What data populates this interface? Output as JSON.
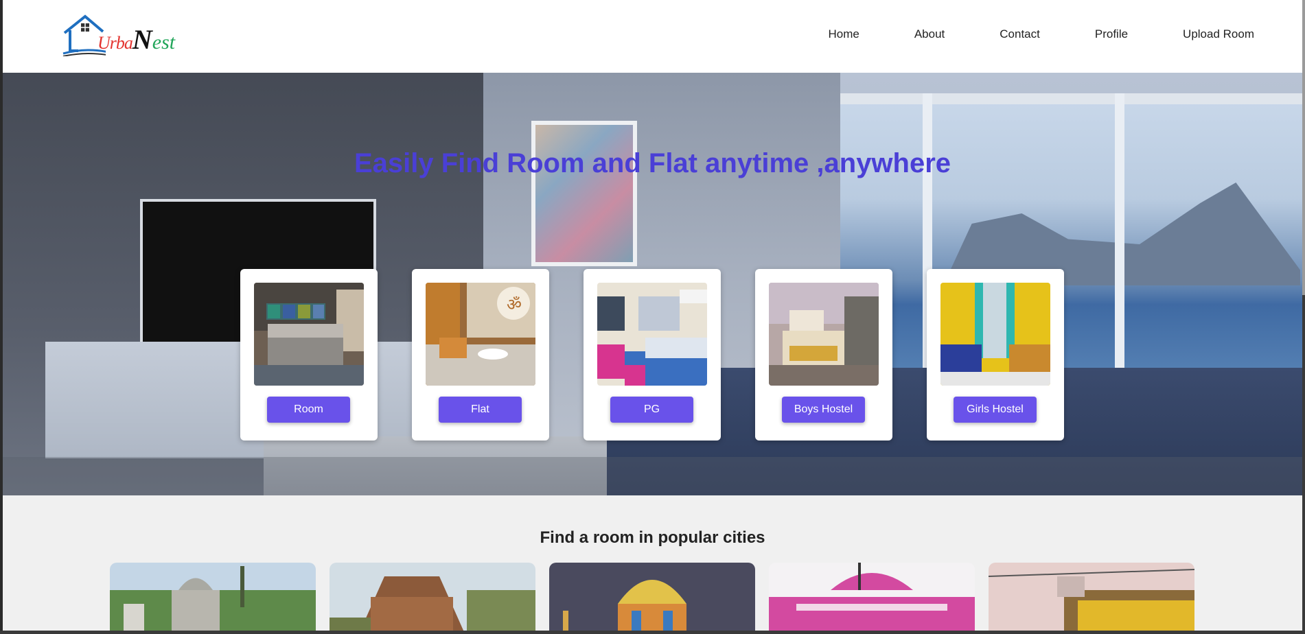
{
  "logo": {
    "part1": "Urba",
    "part2": "N",
    "part3": "est"
  },
  "nav": [
    {
      "label": "Home"
    },
    {
      "label": "About"
    },
    {
      "label": "Contact"
    },
    {
      "label": "Profile"
    },
    {
      "label": "Upload Room"
    }
  ],
  "hero": {
    "title": "Easily Find Room and Flat anytime ,anywhere",
    "categories": [
      {
        "label": "Room"
      },
      {
        "label": "Flat"
      },
      {
        "label": "PG"
      },
      {
        "label": "Boys Hostel"
      },
      {
        "label": "Girls Hostel"
      }
    ]
  },
  "cities": {
    "title": "Find a room in popular cities"
  },
  "colors": {
    "accent": "#6952ea",
    "title": "#4a3fd6"
  }
}
